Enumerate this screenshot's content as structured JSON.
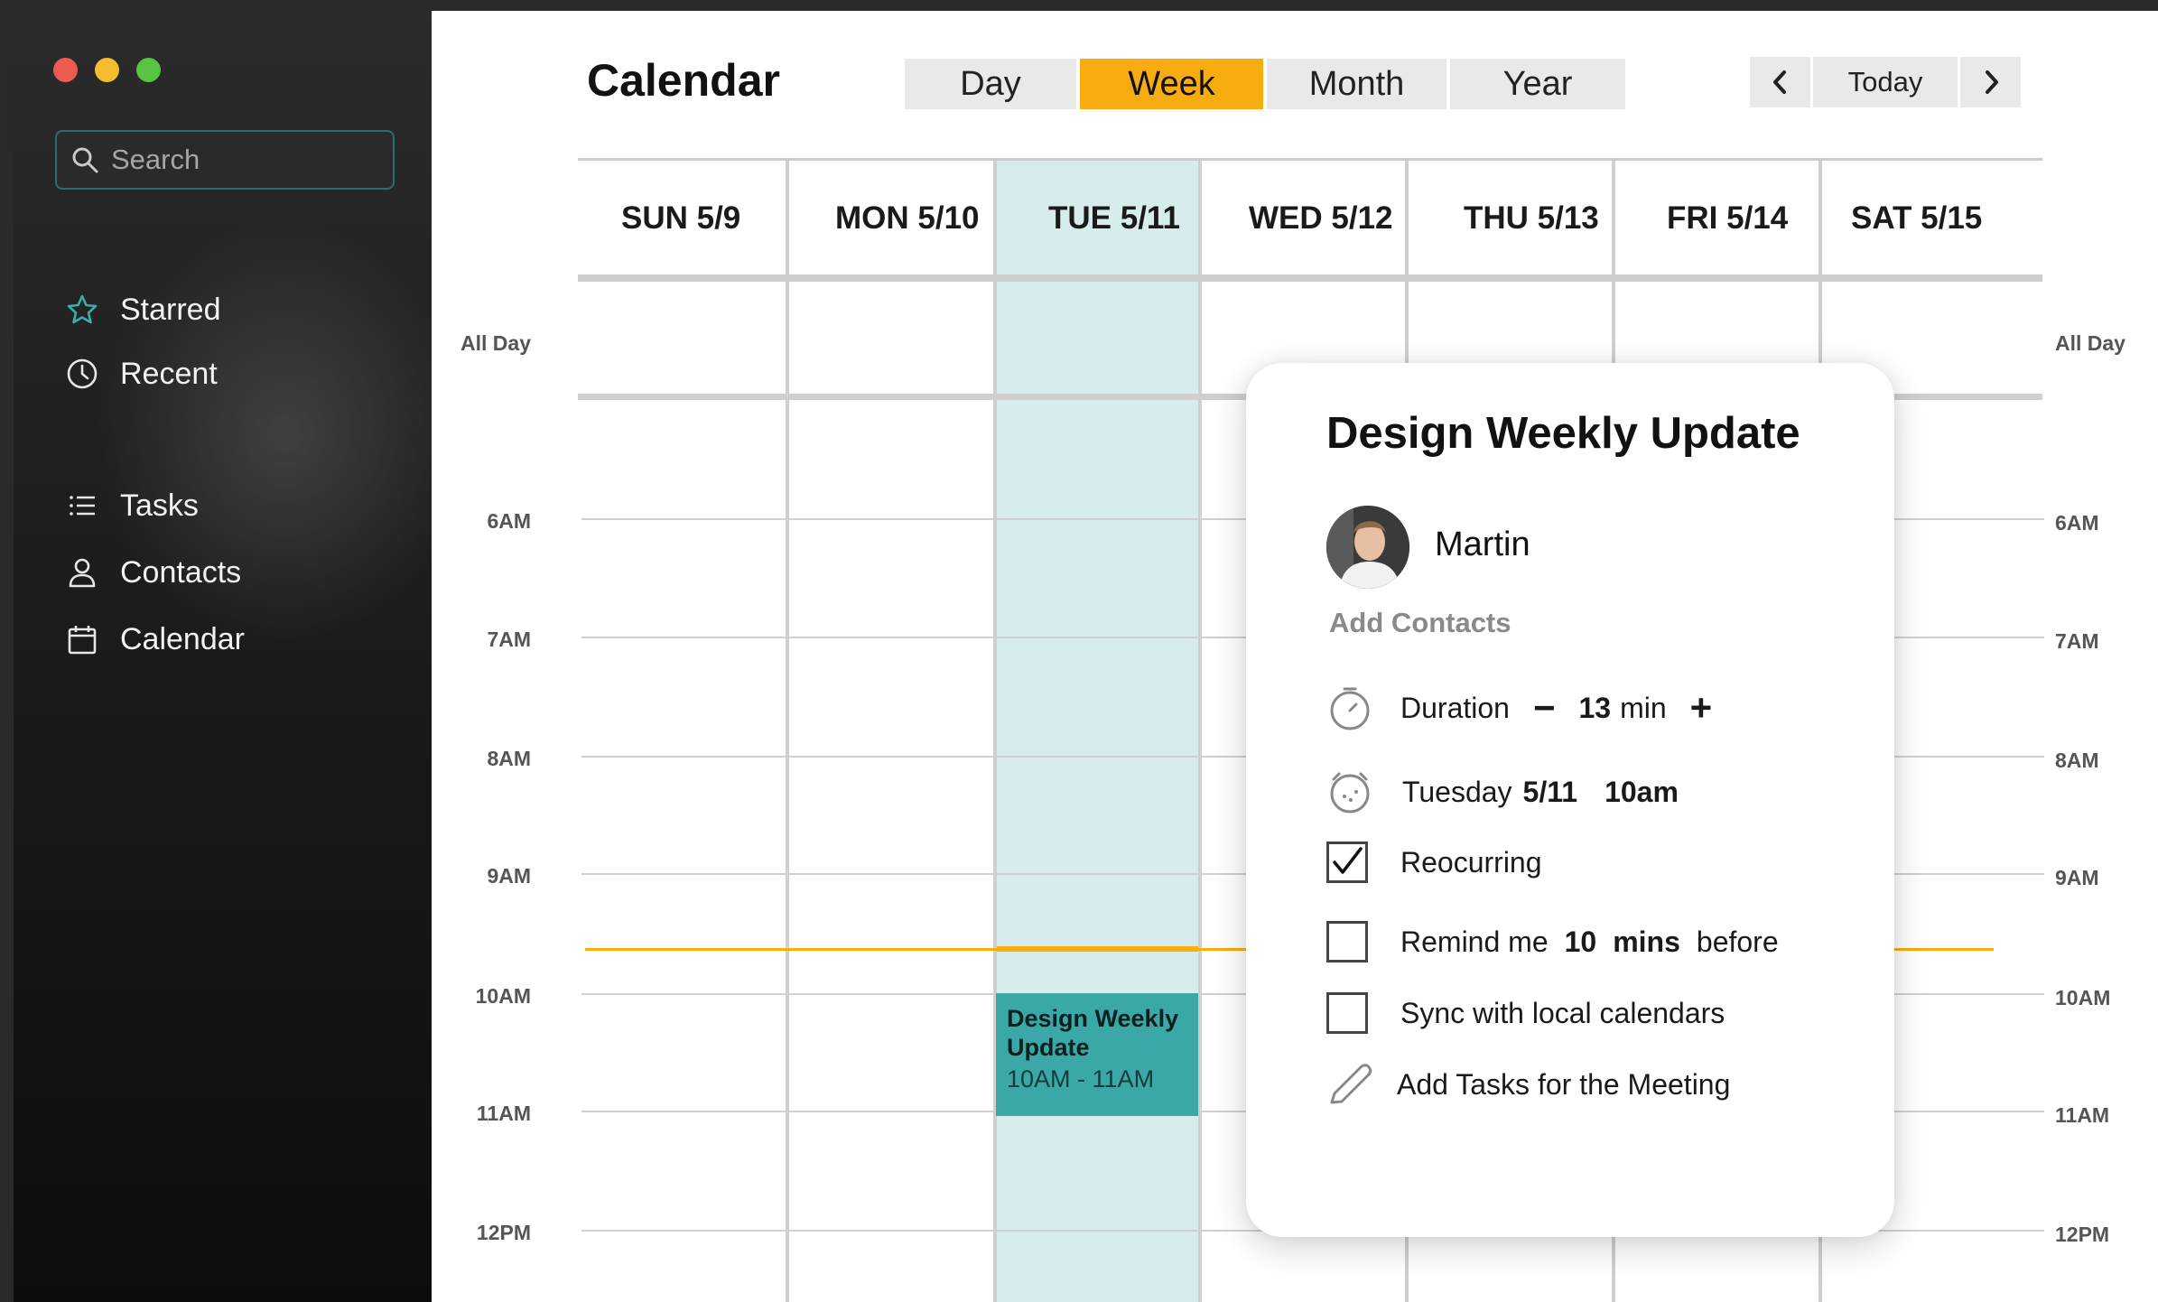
{
  "sidebar": {
    "search_placeholder": "Search",
    "items": [
      {
        "label": "Starred",
        "icon": "star-icon"
      },
      {
        "label": "Recent",
        "icon": "clock-icon"
      },
      {
        "label": "Tasks",
        "icon": "list-icon"
      },
      {
        "label": "Contacts",
        "icon": "person-icon"
      },
      {
        "label": "Calendar",
        "icon": "calendar-icon"
      }
    ]
  },
  "header": {
    "title": "Calendar",
    "view_tabs": [
      "Day",
      "Week",
      "Month",
      "Year"
    ],
    "active_view": "Week",
    "today_label": "Today"
  },
  "week": {
    "days": [
      "SUN 5/9",
      "MON 5/10",
      "TUE 5/11",
      "WED 5/12",
      "THU 5/13",
      "FRI 5/14",
      "SAT 5/15"
    ],
    "today_index": 2,
    "all_day_label": "All Day",
    "hours": [
      "6AM",
      "7AM",
      "8AM",
      "9AM",
      "10AM",
      "11AM",
      "12PM"
    ]
  },
  "event": {
    "title": "Design Weekly Update",
    "time": "10AM - 11AM"
  },
  "popover": {
    "title": "Design Weekly Update",
    "person": "Martin",
    "add_contacts": "Add Contacts",
    "duration_label": "Duration",
    "duration_minus": "−",
    "duration_value": "13",
    "duration_unit": "min",
    "duration_plus": "+",
    "date_day": "Tuesday",
    "date_date": "5/11",
    "date_time": "10am",
    "recurring_label": "Reocurring",
    "recurring_checked": true,
    "remind_prefix": "Remind me",
    "remind_value": "10",
    "remind_unit": "mins",
    "remind_suffix": "before",
    "remind_checked": false,
    "sync_label": "Sync with local calendars",
    "sync_checked": false,
    "add_tasks_label": "Add Tasks for the Meeting"
  },
  "colors": {
    "accent": "#f7ad10",
    "today_column": "#d6eced",
    "event": "#39a8a6",
    "search_border": "#2a6f6a"
  }
}
